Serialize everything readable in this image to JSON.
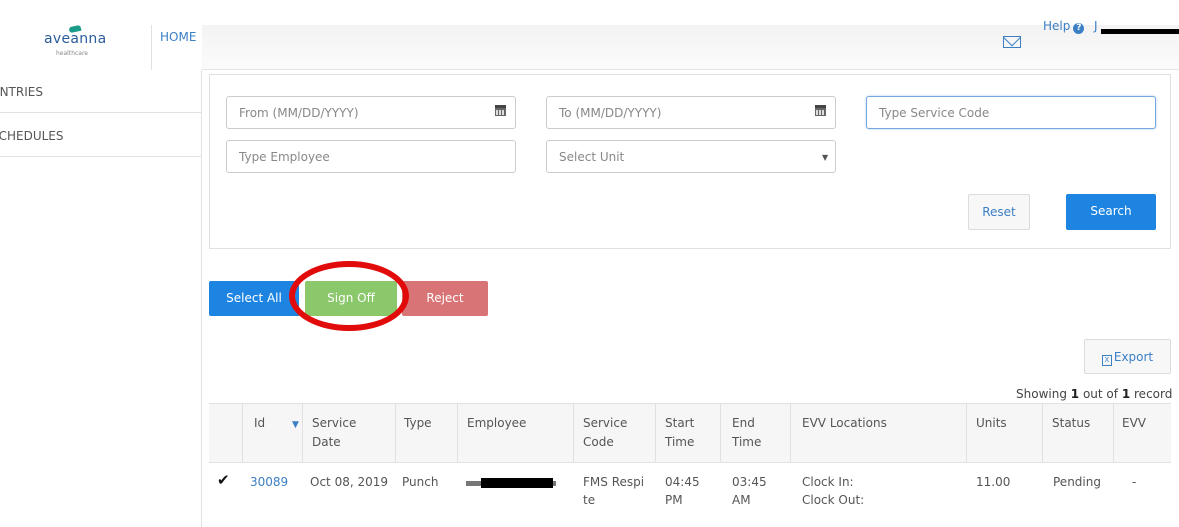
{
  "header": {
    "logo_text": "aveanna",
    "logo_sub": "healthcare",
    "home_tab": "HOME",
    "help_label": "Help",
    "user_initial": "J"
  },
  "sidebar": {
    "items": [
      {
        "label": "ENTRIES"
      },
      {
        "label": "SCHEDULES"
      }
    ]
  },
  "filters": {
    "from_placeholder": "From (MM/DD/YYYY)",
    "to_placeholder": "To (MM/DD/YYYY)",
    "service_code_placeholder": "Type Service Code",
    "employee_placeholder": "Type Employee",
    "unit_selected": "Select Unit",
    "reset_label": "Reset",
    "search_label": "Search"
  },
  "actions": {
    "select_all_label": "Select All",
    "sign_off_label": "Sign Off",
    "reject_label": "Reject",
    "export_label": "Export"
  },
  "showing": {
    "prefix": "Showing",
    "current": "1",
    "middle": "out of",
    "total": "1",
    "suffix": "record"
  },
  "table": {
    "headers": [
      "Id",
      "Service Date",
      "Type",
      "Employee",
      "Service Code",
      "Start Time",
      "End Time",
      "EVV Locations",
      "Units",
      "Status",
      "EVV"
    ],
    "rows": [
      {
        "id": "30089",
        "service_date": "Oct 08, 2019",
        "type": "Punch",
        "service_code_1": "FMS Respi",
        "service_code_2": "te",
        "start_1": "04:45",
        "start_2": "PM",
        "end_1": "03:45",
        "end_2": "AM",
        "evv_1": "Clock In:",
        "evv_2": "Clock Out:",
        "units": "11.00",
        "status": "Pending",
        "evv": "-"
      }
    ]
  },
  "colors": {
    "primary": "#1d84e2",
    "signoff": "#8bc76b",
    "reject": "#d97476",
    "highlight": "#e20b0b",
    "link": "#3b7fc4"
  }
}
